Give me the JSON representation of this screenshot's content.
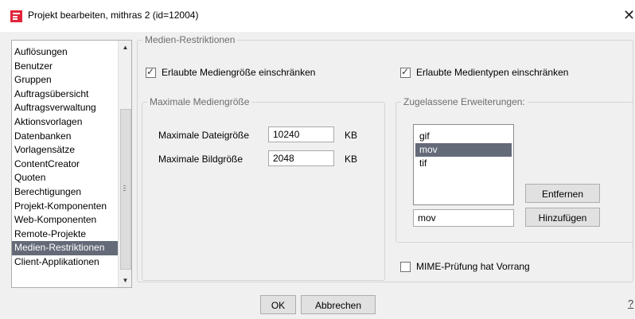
{
  "window": {
    "title": "Projekt bearbeiten, mithras 2 (id=12004)"
  },
  "sidebar": {
    "items": [
      {
        "label": "Auflösungen",
        "selected": false
      },
      {
        "label": "Benutzer",
        "selected": false
      },
      {
        "label": "Gruppen",
        "selected": false
      },
      {
        "label": "Auftragsübersicht",
        "selected": false
      },
      {
        "label": "Auftragsverwaltung",
        "selected": false
      },
      {
        "label": "Aktionsvorlagen",
        "selected": false
      },
      {
        "label": "Datenbanken",
        "selected": false
      },
      {
        "label": "Vorlagensätze",
        "selected": false
      },
      {
        "label": "ContentCreator",
        "selected": false
      },
      {
        "label": "Quoten",
        "selected": false
      },
      {
        "label": "Berechtigungen",
        "selected": false
      },
      {
        "label": "Projekt-Komponenten",
        "selected": false
      },
      {
        "label": "Web-Komponenten",
        "selected": false
      },
      {
        "label": "Remote-Projekte",
        "selected": false
      },
      {
        "label": "Medien-Restriktionen",
        "selected": true
      },
      {
        "label": "Client-Applikationen",
        "selected": false
      }
    ]
  },
  "main": {
    "legend": "Medien-Restriktionen",
    "restrict_size": {
      "label": "Erlaubte Mediengröße einschränken",
      "checked": true
    },
    "restrict_types": {
      "label": "Erlaubte Medientypen einschränken",
      "checked": true
    },
    "size_group": {
      "legend": "Maximale Mediengröße",
      "file_size_label": "Maximale Dateigröße",
      "file_size_value": "10240",
      "file_size_unit": "KB",
      "image_size_label": "Maximale Bildgröße",
      "image_size_value": "2048",
      "image_size_unit": "KB"
    },
    "ext_group": {
      "legend": "Zugelassene Erweiterungen:",
      "items": [
        {
          "label": "gif",
          "selected": false
        },
        {
          "label": "mov",
          "selected": true
        },
        {
          "label": "tif",
          "selected": false
        }
      ],
      "remove_label": "Entfernen",
      "input_value": "mov",
      "add_label": "Hinzufügen"
    },
    "mime_check": {
      "label": "MIME-Prüfung hat Vorrang",
      "checked": false
    }
  },
  "footer": {
    "ok_label": "OK",
    "cancel_label": "Abbrechen",
    "help_label": "?"
  }
}
